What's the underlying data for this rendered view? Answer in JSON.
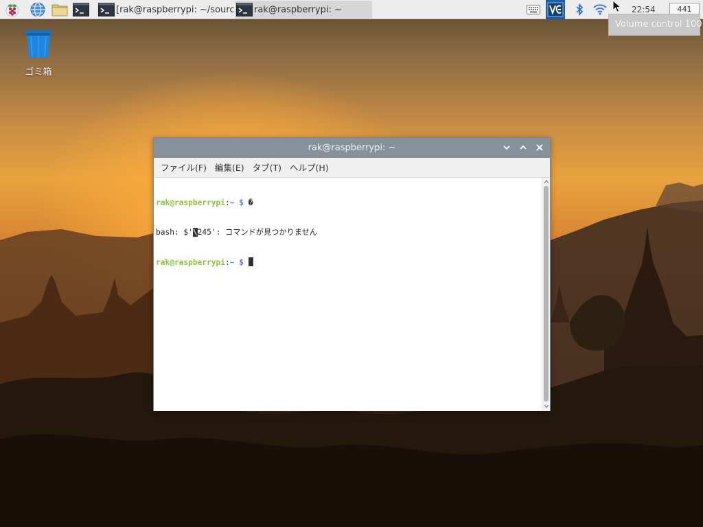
{
  "panel": {
    "tasks": [
      {
        "label": "[rak@raspberrypi: ~/sourc…"
      },
      {
        "label": "rak@raspberrypi: ~"
      }
    ],
    "clock": "22:54",
    "keyboard_indicator": "441",
    "tooltip": "Volume control 100"
  },
  "desktop": {
    "trash_label": "ゴミ箱"
  },
  "terminal": {
    "title": "rak@raspberrypi: ~",
    "menu": [
      "ファイル(F)",
      "編集(E)",
      "タブ(T)",
      "ヘルプ(H)"
    ],
    "prompt_user": "rak@raspberrypi",
    "prompt_sep": ":",
    "prompt_path": "~",
    "prompt_dollar": "$",
    "line1_input": "�",
    "line2_prefix": "bash: $'",
    "line2_box": "\\",
    "line2_rest": "245': コマンドが見つかりません"
  },
  "colors": {
    "panel_bg": "#ededed",
    "titlebar": "#87919c",
    "prompt_user": "#8ac43a",
    "prompt_path": "#5a7fd6",
    "tray_vnc": "#1c5fa8",
    "tray_accent": "#2a6fd6"
  }
}
